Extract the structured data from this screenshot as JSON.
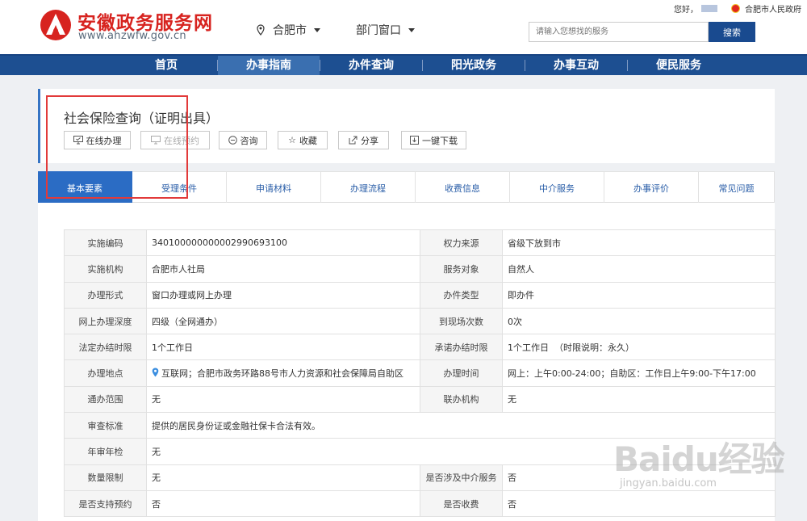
{
  "site": {
    "name_cn": "安徽政务服务网",
    "domain": "www.ahzwfw.gov.cn",
    "brand_red": "#d7231f",
    "brand_blue": "#1d4f91"
  },
  "header": {
    "city": "合肥市",
    "dept_window": "部门窗口",
    "greeting": "您好，",
    "gov_link": "合肥市人民政府",
    "search_placeholder": "请输入您想找的服务",
    "search_button": "搜索"
  },
  "nav": {
    "items": [
      "首页",
      "办事指南",
      "办件查询",
      "阳光政务",
      "办事互动",
      "便民服务"
    ],
    "active_index": 1
  },
  "page": {
    "title": "社会保险查询（证明出具）",
    "actions": [
      {
        "label": "在线办理",
        "icon": "monitor-icon",
        "enabled": true
      },
      {
        "label": "在线预约",
        "icon": "monitor-icon",
        "enabled": false
      },
      {
        "label": "咨询",
        "icon": "chat-icon",
        "enabled": true
      },
      {
        "label": "收藏",
        "icon": "star-icon",
        "enabled": true
      },
      {
        "label": "分享",
        "icon": "share-icon",
        "enabled": true
      },
      {
        "label": "一键下载",
        "icon": "download-icon",
        "enabled": true
      }
    ]
  },
  "tabs": {
    "items": [
      "基本要素",
      "受理条件",
      "申请材料",
      "办理流程",
      "收费信息",
      "中介服务",
      "办事评价",
      "常见问题"
    ],
    "active_index": 0
  },
  "info": {
    "impl_code_label": "实施编码",
    "impl_code": "340100000000002990693100",
    "power_source_label": "权力来源",
    "power_source": "省级下放到市",
    "impl_org_label": "实施机构",
    "impl_org": "合肥市人社局",
    "service_target_label": "服务对象",
    "service_target": "自然人",
    "handle_form_label": "办理形式",
    "handle_form": "窗口办理或网上办理",
    "item_type_label": "办件类型",
    "item_type": "即办件",
    "online_depth_label": "网上办理深度",
    "online_depth": "四级（全网通办）",
    "visits_label": "到现场次数",
    "visits": "0次",
    "legal_limit_label": "法定办结时限",
    "legal_limit": "1个工作日",
    "promise_limit_label": "承诺办结时限",
    "promise_limit": "1个工作日  （时限说明：永久）",
    "location_label": "办理地点",
    "location": "互联网；合肥市政务环路88号市人力资源和社会保障局自助区",
    "hours_label": "办理时间",
    "hours": "网上：上午0:00-24:00；自助区：工作日上午9:00-下午17:00",
    "scope_label": "通办范围",
    "scope": "无",
    "joint_org_label": "联办机构",
    "joint_org": "无",
    "review_label": "审查标准",
    "review": "提供的居民身份证或金融社保卡合法有效。",
    "annual_label": "年审年检",
    "annual": "无",
    "quantity_label": "数量限制",
    "quantity": "无",
    "intermediary_label": "是否涉及中介服务",
    "intermediary": "否",
    "booking_label": "是否支持预约",
    "booking": "否",
    "fee_label": "是否收费",
    "fee": "否"
  },
  "watermark": {
    "brand": "Baidu经验",
    "url": "jingyan.baidu.com"
  }
}
